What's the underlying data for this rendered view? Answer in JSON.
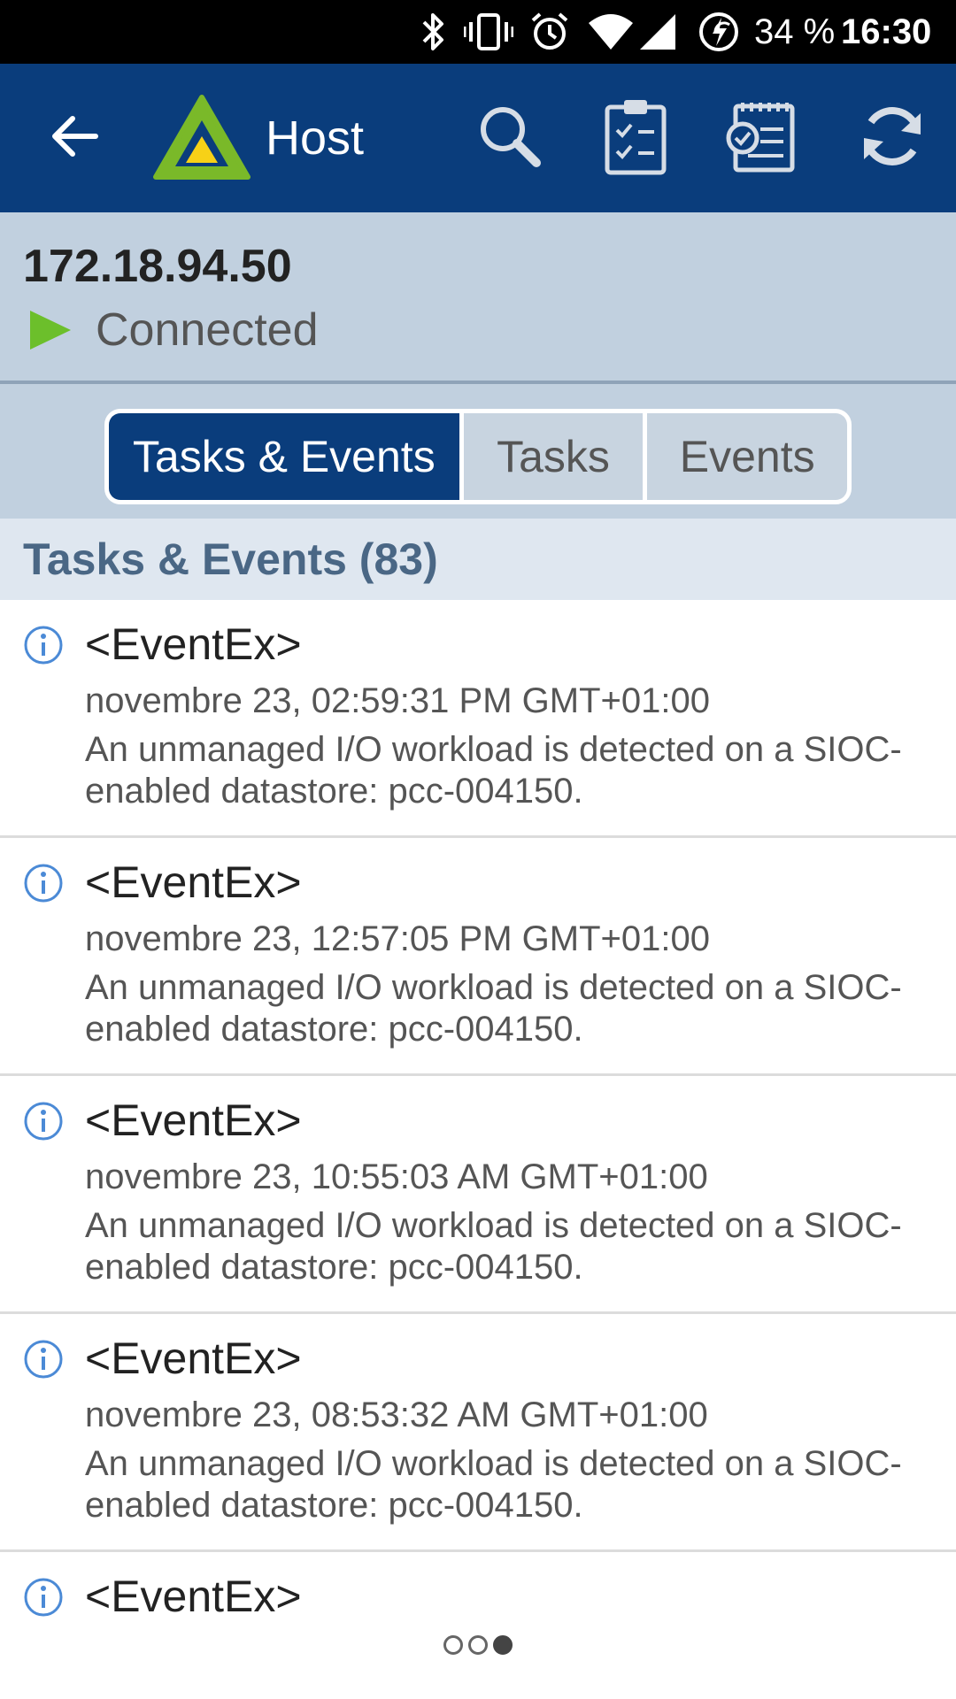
{
  "status_bar": {
    "battery": "34 %",
    "time": "16:30",
    "icons": [
      "bluetooth-icon",
      "vibrate-icon",
      "alarm-icon",
      "wifi-icon",
      "cellular-signal-icon",
      "battery-charging-icon"
    ]
  },
  "app_bar": {
    "title": "Host",
    "colors": {
      "background": "#0a3d7c",
      "logo_green": "#7ab929",
      "logo_yellow": "#f7d117"
    },
    "actions": [
      "back-icon",
      "search-icon",
      "clipboard-check-icon",
      "notepad-check-icon",
      "refresh-icon"
    ]
  },
  "host": {
    "ip": "172.18.94.50",
    "status": "Connected",
    "status_color": "#6cbf2b"
  },
  "tabs": [
    {
      "label": "Tasks & Events",
      "active": true
    },
    {
      "label": "Tasks",
      "active": false
    },
    {
      "label": "Events",
      "active": false
    }
  ],
  "section": {
    "title": "Tasks & Events (83)"
  },
  "items": [
    {
      "title": "<EventEx>",
      "date": "novembre 23, 02:59:31 PM GMT+01:00",
      "description": "An unmanaged I/O workload is detected on a SIOC-enabled datastore: pcc-004150."
    },
    {
      "title": "<EventEx>",
      "date": "novembre 23, 12:57:05 PM GMT+01:00",
      "description": "An unmanaged I/O workload is detected on a SIOC-enabled datastore: pcc-004150."
    },
    {
      "title": "<EventEx>",
      "date": "novembre 23, 10:55:03 AM GMT+01:00",
      "description": "An unmanaged I/O workload is detected on a SIOC-enabled datastore: pcc-004150."
    },
    {
      "title": "<EventEx>",
      "date": "novembre 23, 08:53:32 AM GMT+01:00",
      "description": "An unmanaged I/O workload is detected on a SIOC-enabled datastore: pcc-004150."
    },
    {
      "title": "<EventEx>"
    }
  ],
  "page_indicator": {
    "count": 3,
    "active": 3
  }
}
